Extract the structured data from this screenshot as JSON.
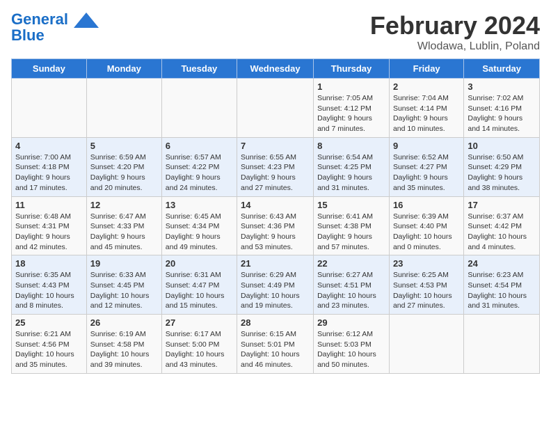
{
  "header": {
    "logo_line1": "General",
    "logo_line2": "Blue",
    "title": "February 2024",
    "subtitle": "Wlodawa, Lublin, Poland"
  },
  "weekdays": [
    "Sunday",
    "Monday",
    "Tuesday",
    "Wednesday",
    "Thursday",
    "Friday",
    "Saturday"
  ],
  "weeks": [
    [
      {
        "day": "",
        "info": ""
      },
      {
        "day": "",
        "info": ""
      },
      {
        "day": "",
        "info": ""
      },
      {
        "day": "",
        "info": ""
      },
      {
        "day": "1",
        "info": "Sunrise: 7:05 AM\nSunset: 4:12 PM\nDaylight: 9 hours and 7 minutes."
      },
      {
        "day": "2",
        "info": "Sunrise: 7:04 AM\nSunset: 4:14 PM\nDaylight: 9 hours and 10 minutes."
      },
      {
        "day": "3",
        "info": "Sunrise: 7:02 AM\nSunset: 4:16 PM\nDaylight: 9 hours and 14 minutes."
      }
    ],
    [
      {
        "day": "4",
        "info": "Sunrise: 7:00 AM\nSunset: 4:18 PM\nDaylight: 9 hours and 17 minutes."
      },
      {
        "day": "5",
        "info": "Sunrise: 6:59 AM\nSunset: 4:20 PM\nDaylight: 9 hours and 20 minutes."
      },
      {
        "day": "6",
        "info": "Sunrise: 6:57 AM\nSunset: 4:22 PM\nDaylight: 9 hours and 24 minutes."
      },
      {
        "day": "7",
        "info": "Sunrise: 6:55 AM\nSunset: 4:23 PM\nDaylight: 9 hours and 27 minutes."
      },
      {
        "day": "8",
        "info": "Sunrise: 6:54 AM\nSunset: 4:25 PM\nDaylight: 9 hours and 31 minutes."
      },
      {
        "day": "9",
        "info": "Sunrise: 6:52 AM\nSunset: 4:27 PM\nDaylight: 9 hours and 35 minutes."
      },
      {
        "day": "10",
        "info": "Sunrise: 6:50 AM\nSunset: 4:29 PM\nDaylight: 9 hours and 38 minutes."
      }
    ],
    [
      {
        "day": "11",
        "info": "Sunrise: 6:48 AM\nSunset: 4:31 PM\nDaylight: 9 hours and 42 minutes."
      },
      {
        "day": "12",
        "info": "Sunrise: 6:47 AM\nSunset: 4:33 PM\nDaylight: 9 hours and 45 minutes."
      },
      {
        "day": "13",
        "info": "Sunrise: 6:45 AM\nSunset: 4:34 PM\nDaylight: 9 hours and 49 minutes."
      },
      {
        "day": "14",
        "info": "Sunrise: 6:43 AM\nSunset: 4:36 PM\nDaylight: 9 hours and 53 minutes."
      },
      {
        "day": "15",
        "info": "Sunrise: 6:41 AM\nSunset: 4:38 PM\nDaylight: 9 hours and 57 minutes."
      },
      {
        "day": "16",
        "info": "Sunrise: 6:39 AM\nSunset: 4:40 PM\nDaylight: 10 hours and 0 minutes."
      },
      {
        "day": "17",
        "info": "Sunrise: 6:37 AM\nSunset: 4:42 PM\nDaylight: 10 hours and 4 minutes."
      }
    ],
    [
      {
        "day": "18",
        "info": "Sunrise: 6:35 AM\nSunset: 4:43 PM\nDaylight: 10 hours and 8 minutes."
      },
      {
        "day": "19",
        "info": "Sunrise: 6:33 AM\nSunset: 4:45 PM\nDaylight: 10 hours and 12 minutes."
      },
      {
        "day": "20",
        "info": "Sunrise: 6:31 AM\nSunset: 4:47 PM\nDaylight: 10 hours and 15 minutes."
      },
      {
        "day": "21",
        "info": "Sunrise: 6:29 AM\nSunset: 4:49 PM\nDaylight: 10 hours and 19 minutes."
      },
      {
        "day": "22",
        "info": "Sunrise: 6:27 AM\nSunset: 4:51 PM\nDaylight: 10 hours and 23 minutes."
      },
      {
        "day": "23",
        "info": "Sunrise: 6:25 AM\nSunset: 4:53 PM\nDaylight: 10 hours and 27 minutes."
      },
      {
        "day": "24",
        "info": "Sunrise: 6:23 AM\nSunset: 4:54 PM\nDaylight: 10 hours and 31 minutes."
      }
    ],
    [
      {
        "day": "25",
        "info": "Sunrise: 6:21 AM\nSunset: 4:56 PM\nDaylight: 10 hours and 35 minutes."
      },
      {
        "day": "26",
        "info": "Sunrise: 6:19 AM\nSunset: 4:58 PM\nDaylight: 10 hours and 39 minutes."
      },
      {
        "day": "27",
        "info": "Sunrise: 6:17 AM\nSunset: 5:00 PM\nDaylight: 10 hours and 43 minutes."
      },
      {
        "day": "28",
        "info": "Sunrise: 6:15 AM\nSunset: 5:01 PM\nDaylight: 10 hours and 46 minutes."
      },
      {
        "day": "29",
        "info": "Sunrise: 6:12 AM\nSunset: 5:03 PM\nDaylight: 10 hours and 50 minutes."
      },
      {
        "day": "",
        "info": ""
      },
      {
        "day": "",
        "info": ""
      }
    ]
  ]
}
